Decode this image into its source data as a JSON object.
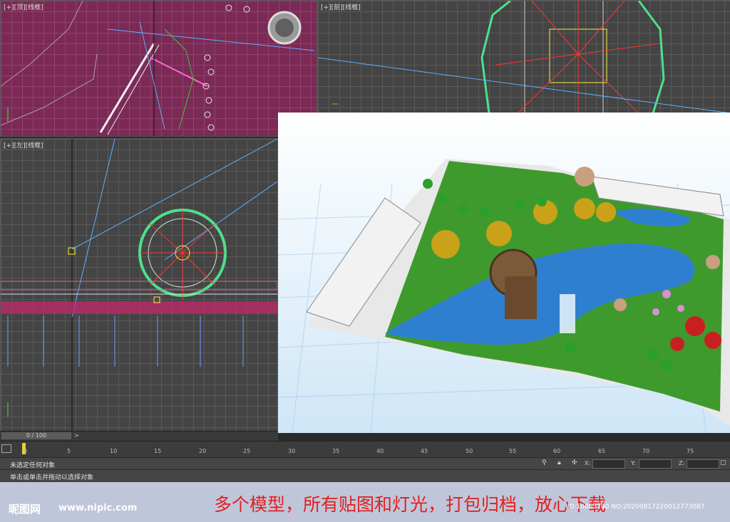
{
  "viewports": {
    "top": {
      "label": "[+][顶][线框]"
    },
    "front": {
      "label": "[+][前][线框]"
    },
    "left": {
      "label": "[+][左][线框]"
    }
  },
  "frame_slider": {
    "value": "0 / 100",
    "next": ">"
  },
  "timeline": {
    "ticks": [
      "0",
      "5",
      "10",
      "15",
      "20",
      "25",
      "30",
      "35",
      "40",
      "45",
      "50",
      "55",
      "60",
      "65",
      "70",
      "75"
    ]
  },
  "status": {
    "selection": "未选定任何对象",
    "prompt": "单击或单击并拖动以选择对象",
    "x_label": "X:",
    "y_label": "Y:",
    "z_label": "Z:"
  },
  "banner": {
    "logo": "昵图网",
    "url": "www.nipic.com",
    "slogan": "多个模型，所有贴图和灯光，打包归档，放心下载",
    "id_text": "ID:10083740 NO:20200817220012773087"
  },
  "colors": {
    "slogan": "#e02020",
    "banner_bg": "#c0c6da",
    "grass": "#3f9a2e",
    "water": "#2f7fd0"
  }
}
